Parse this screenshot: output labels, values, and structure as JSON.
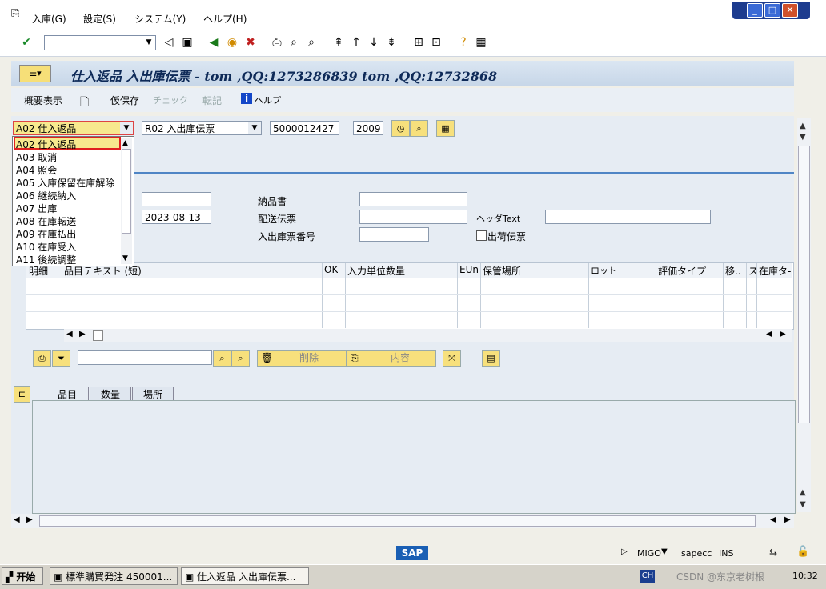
{
  "menu": {
    "items": [
      "入庫(G)",
      "設定(S)",
      "システム(Y)",
      "ヘルプ(H)"
    ]
  },
  "window_controls": {
    "minimize": "_",
    "restore": "□",
    "close": "✕"
  },
  "title": {
    "text": "仕入返品 入出庫伝票 - tom ,QQ:1273286839 tom ,QQ:12732868"
  },
  "app_toolbar": {
    "overview": "概要表示",
    "hold": "仮保存",
    "check": "チェック",
    "post": "転記",
    "help": "ヘルプ"
  },
  "header_row": {
    "action_value": "A02 仕入返品",
    "ref_doc_value": "R02 入出庫伝票",
    "doc_number": "5000012427",
    "year": "2009"
  },
  "action_options": [
    "A02 仕入返品",
    "A03 取消",
    "A04 照会",
    "A05 入庫保留在庫解除",
    "A06 継続納入",
    "A07 出庫",
    "A08 在庫転送",
    "A09 在庫払出",
    "A10 在庫受入",
    "A11 後続調整"
  ],
  "header_fields": {
    "doc_date": "",
    "posting_date": "2023-08-13",
    "delivery_note_label": "納品書",
    "delivery_note_value": "",
    "bill_of_lading_label": "配送伝票",
    "bill_of_lading_value": "",
    "gr_slip_label": "入出庫票番号",
    "gr_slip_value": "",
    "header_text_label": "ヘッダText",
    "header_text_value": "",
    "print_label": "出荷伝票"
  },
  "table": {
    "columns": [
      "明細",
      "品目テキスト (短)",
      "OK",
      "入力単位数量",
      "EUn",
      "保管場所",
      "ロット",
      "評価タイプ",
      "移..",
      "ス",
      "在庫タ-"
    ]
  },
  "item_toolbar": {
    "delete": "削除",
    "content": "内容"
  },
  "tabs": [
    "品目",
    "数量",
    "場所"
  ],
  "status": {
    "transaction": "MIGO",
    "system": "sapecc",
    "mode": "INS",
    "sap_logo": "SAP"
  },
  "taskbar": {
    "start": "开始",
    "task1": "標準購買発注 450001...",
    "task2": "仕入返品 入出庫伝票...",
    "lang": "CH",
    "clock": "10:32",
    "watermark": "CSDN @东京老树根"
  }
}
